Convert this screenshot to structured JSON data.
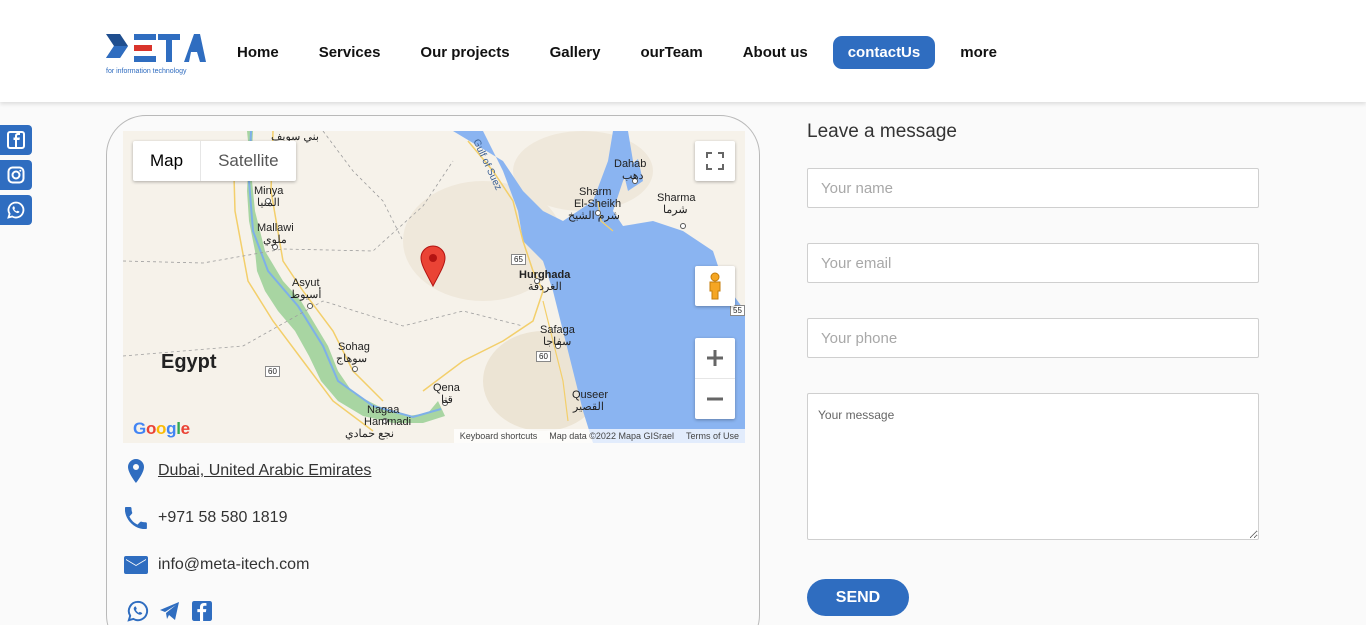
{
  "brand": {
    "logo_text": "META",
    "logo_subtitle": "for information technology",
    "primary_color": "#2f6dc0"
  },
  "nav": {
    "items": [
      {
        "label": "Home",
        "active": false
      },
      {
        "label": "Services",
        "active": false
      },
      {
        "label": "Our projects",
        "active": false
      },
      {
        "label": "Gallery",
        "active": false
      },
      {
        "label": "ourTeam",
        "active": false
      },
      {
        "label": "About us",
        "active": false
      },
      {
        "label": "contactUs",
        "active": true
      },
      {
        "label": "more",
        "active": false
      }
    ]
  },
  "side_social": [
    "facebook-icon",
    "instagram-icon",
    "whatsapp-icon"
  ],
  "map": {
    "type_map": "Map",
    "type_satellite": "Satellite",
    "country_label": "Egypt",
    "places": {
      "bani_suwayf": "بني سويف",
      "minya": "Minya",
      "minya_ar": "المنيا",
      "mallawi": "Mallawi",
      "mallawi_ar": "ملوي",
      "asyut": "Asyut",
      "asyut_ar": "أسيوط",
      "sohag": "Sohag",
      "sohag_ar": "سوهاج",
      "nagaa": "Nagaa",
      "hammadi": "Hammadi",
      "hammadi_ar": "نجع حمادي",
      "qena": "Qena",
      "qena_ar": "قنا",
      "hurghada": "Hurghada",
      "hurghada_ar": "الغردقة",
      "safaga": "Safaga",
      "safaga_ar": "سفاجا",
      "quseer": "Quseer",
      "quseer_ar": "القصير",
      "dahab": "Dahab",
      "dahab_ar": "دهب",
      "sharm": "Sharm",
      "el_sheikh": "El-Sheikh",
      "sharm_ar": "شرم الشيخ",
      "sharma": "Sharma",
      "sharma_ar": "شرما",
      "gulf_of_suez": "Gulf of Suez"
    },
    "road_shields": [
      "65",
      "60",
      "60",
      "55"
    ],
    "google_logo": "Google",
    "footer": {
      "shortcuts": "Keyboard shortcuts",
      "data": "Map data ©2022 Mapa GISrael",
      "terms": "Terms of Use"
    }
  },
  "contact": {
    "address": "Dubai, United Arabic Emirates",
    "phone": "+971 58 580 1819",
    "email": "info@meta-itech.com"
  },
  "card_social": [
    "whatsapp-icon",
    "telegram-icon",
    "facebook-icon"
  ],
  "form": {
    "title": "Leave a message",
    "name_placeholder": "Your name",
    "email_placeholder": "Your email",
    "phone_placeholder": "Your phone",
    "message_placeholder": "Your message",
    "send_label": "SEND"
  }
}
